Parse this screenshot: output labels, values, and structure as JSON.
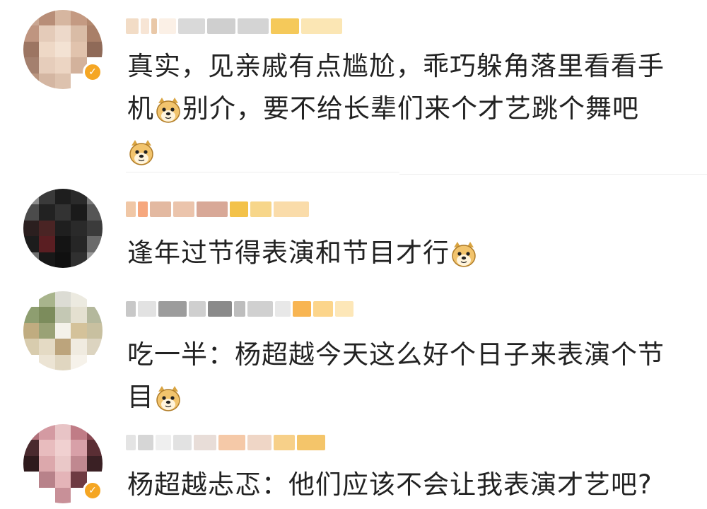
{
  "comments": [
    {
      "text_parts": [
        "真实，见亲戚有点尴尬，乖巧躲角落里看看手机",
        "别介，要不给长辈们来个才艺跳个舞吧",
        ""
      ],
      "verified": true
    },
    {
      "text_parts": [
        "逢年过节得表演和节目才行",
        ""
      ],
      "verified": false
    },
    {
      "text_parts": [
        "吃一半：杨超越今天这么好个日子来表演个节目",
        ""
      ],
      "verified": false
    },
    {
      "text_parts": [
        "杨超越忐忑：他们应该不会让我表演才艺吧?"
      ],
      "verified": true
    }
  ],
  "emoji": "doge-emoji",
  "colors": {
    "accent": "#f5a623",
    "text": "#222222",
    "divider": "#eeeeee"
  }
}
